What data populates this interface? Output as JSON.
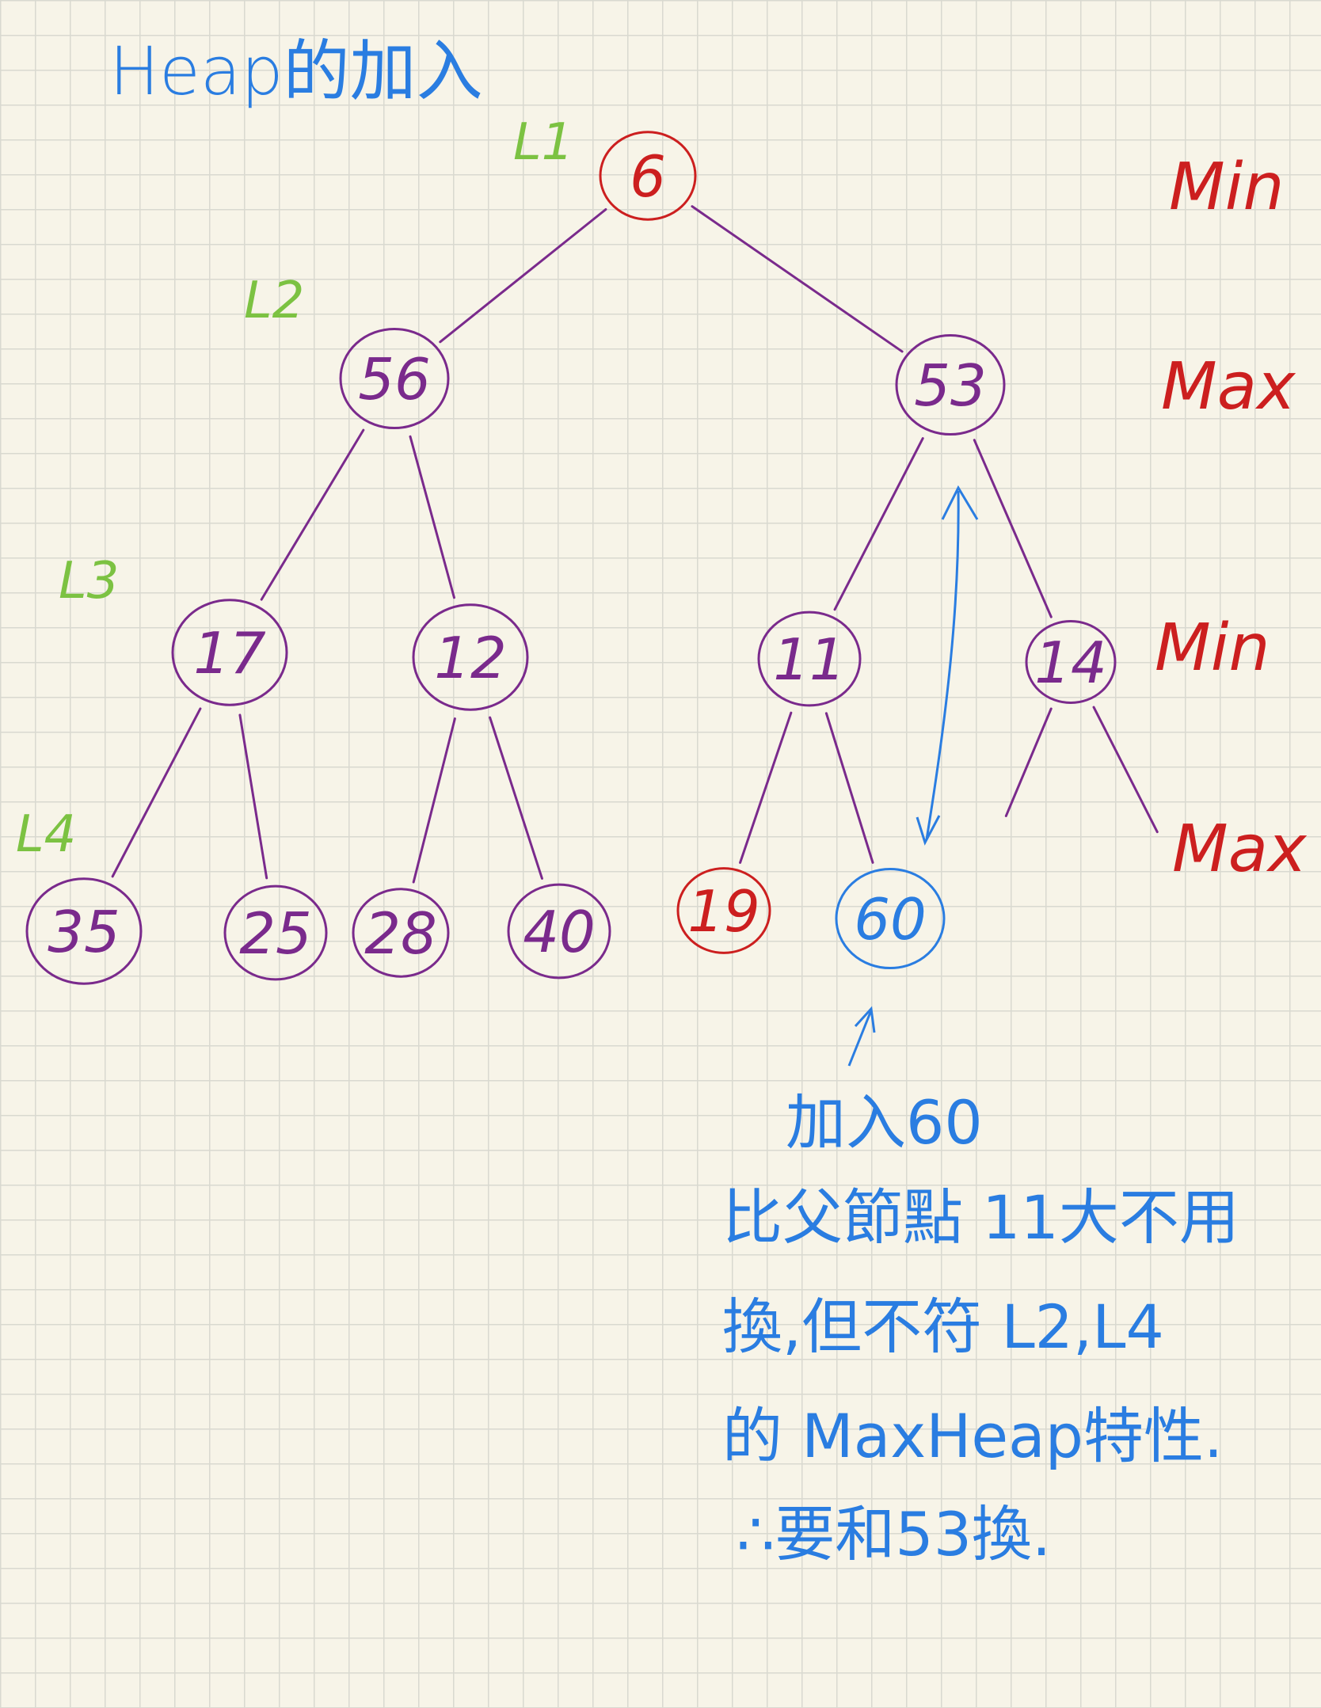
{
  "title": "Heap的加入",
  "levels": [
    "L1",
    "L2",
    "L3",
    "L4"
  ],
  "level_types": [
    "Min",
    "Max",
    "Min",
    "Max"
  ],
  "nodes": [
    {
      "id": "n6",
      "label": "6",
      "color": "#cc1f1f"
    },
    {
      "id": "n56",
      "label": "56",
      "color": "#7a2a8c"
    },
    {
      "id": "n53",
      "label": "53",
      "color": "#7a2a8c"
    },
    {
      "id": "n17",
      "label": "17",
      "color": "#7a2a8c"
    },
    {
      "id": "n12",
      "label": "12",
      "color": "#7a2a8c"
    },
    {
      "id": "n11",
      "label": "11",
      "color": "#7a2a8c"
    },
    {
      "id": "n14",
      "label": "14",
      "color": "#7a2a8c"
    },
    {
      "id": "n35",
      "label": "35",
      "color": "#7a2a8c"
    },
    {
      "id": "n25",
      "label": "25",
      "color": "#7a2a8c"
    },
    {
      "id": "n28",
      "label": "28",
      "color": "#7a2a8c"
    },
    {
      "id": "n40",
      "label": "40",
      "color": "#7a2a8c"
    },
    {
      "id": "n19",
      "label": "19",
      "color": "#cc1f1f"
    },
    {
      "id": "n60",
      "label": "60",
      "color": "#2a7de1"
    }
  ],
  "edges": [
    [
      "n6",
      "n56"
    ],
    [
      "n6",
      "n53"
    ],
    [
      "n56",
      "n17"
    ],
    [
      "n56",
      "n12"
    ],
    [
      "n53",
      "n11"
    ],
    [
      "n53",
      "n14"
    ],
    [
      "n17",
      "n35"
    ],
    [
      "n17",
      "n25"
    ],
    [
      "n12",
      "n28"
    ],
    [
      "n12",
      "n40"
    ],
    [
      "n11",
      "n19"
    ],
    [
      "n11",
      "n60"
    ],
    [
      "n14",
      "stub-left"
    ],
    [
      "n14",
      "stub-right"
    ]
  ],
  "note": {
    "line1": "加入60",
    "line2": "比父節點 11大不用",
    "line3": "換,但不符 L2,L4",
    "line4": "的 MaxHeap特性.",
    "line5": "∴要和53換."
  },
  "colors": {
    "tree": "#7a2a8c",
    "inserted": "#2a7de1",
    "min_label": "#cc1f1f",
    "level_label": "#7cc242",
    "background": "#f7f4e8"
  }
}
